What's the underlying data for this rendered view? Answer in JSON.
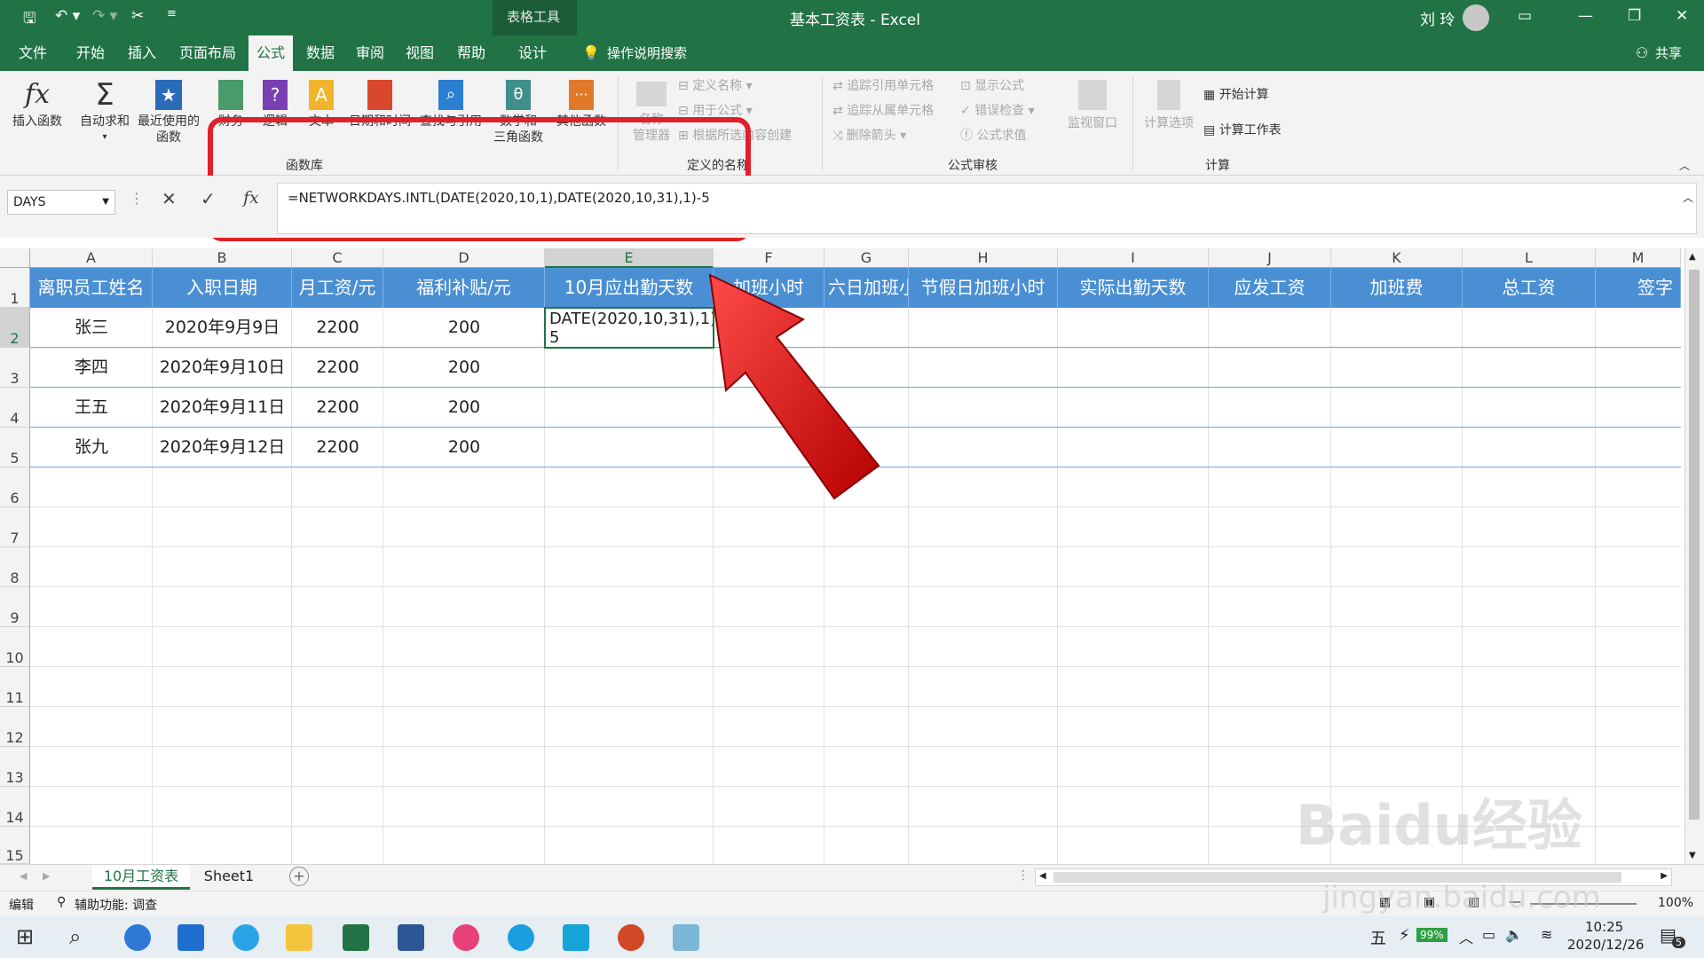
{
  "title_bar": {
    "tools_label": "表格工具",
    "title": "基本工资表 - Excel",
    "user": "刘 玲"
  },
  "tabs": [
    "文件",
    "开始",
    "插入",
    "页面布局",
    "公式",
    "数据",
    "审阅",
    "视图",
    "帮助",
    "设计"
  ],
  "search_label": "操作说明搜索",
  "share_label": "共享",
  "ribbon": {
    "insert_function": "插入函数",
    "autosum": "自动求和",
    "recent_l1": "最近使用的",
    "recent_l2": "函数",
    "financial": "财务",
    "logical": "逻辑",
    "text": "文本",
    "datetime": "日期和时间",
    "lookup": "查找与引用",
    "math_l1": "数学和",
    "math_l2": "三角函数",
    "more": "其他函数",
    "group_library": "函数库",
    "name_manager_l1": "名称",
    "name_manager_l2": "管理器",
    "define_name": "定义名称",
    "use_in_formula": "用于公式",
    "create_from_selection": "根据所选内容创建",
    "group_names": "定义的名称",
    "trace_precedents": "追踪引用单元格",
    "trace_dependents": "追踪从属单元格",
    "remove_arrows": "删除箭头",
    "show_formulas": "显示公式",
    "error_checking": "错误检查",
    "evaluate_formula": "公式求值",
    "watch_window": "监视窗口",
    "group_auditing": "公式审核",
    "calc_options": "计算选项",
    "calc_now": "开始计算",
    "calc_sheet": "计算工作表",
    "group_calc": "计算"
  },
  "formula_bar": {
    "name_box": "DAYS",
    "formula": "=NETWORKDAYS.INTL(DATE(2020,10,1),DATE(2020,10,31),1)-5"
  },
  "columns": [
    "A",
    "B",
    "C",
    "D",
    "E",
    "F",
    "G",
    "H",
    "I",
    "J",
    "K",
    "L",
    "M"
  ],
  "rows": [
    "1",
    "2",
    "3",
    "4",
    "5",
    "6",
    "7",
    "8",
    "9",
    "10",
    "11",
    "12",
    "13",
    "14",
    "15"
  ],
  "headers": [
    "离职员工姓名",
    "入职日期",
    "月工资/元",
    "福利补贴/元",
    "10月应出勤天数",
    "加班小时",
    "六日加班小",
    "节假日加班小时",
    "实际出勤天数",
    "应发工资",
    "加班费",
    "总工资",
    "签字"
  ],
  "data_rows": [
    [
      "张三",
      "2020年9月9日",
      "2200",
      "200"
    ],
    [
      "李四",
      "2020年9月10日",
      "2200",
      "200"
    ],
    [
      "王五",
      "2020年9月11日",
      "2200",
      "200"
    ],
    [
      "张九",
      "2020年9月12日",
      "2200",
      "200"
    ]
  ],
  "editing_cell_l1": "DATE(2020,10,31),1)-",
  "editing_cell_l2": "5",
  "sheets": [
    "10月工资表",
    "Sheet1"
  ],
  "status": {
    "mode": "编辑",
    "accessibility": "辅助功能: 调查",
    "zoom": "100%"
  },
  "watermark": "Baidu经验",
  "watermark_url": "jingyan.baidu.com",
  "taskbar": {
    "ime": "五",
    "battery": "99%",
    "time": "10:25",
    "date": "2020/12/26",
    "notif": "5"
  },
  "colors": {
    "excel_green": "#217346",
    "header_blue": "#4a8fd4",
    "highlight_red": "#e0202a"
  }
}
